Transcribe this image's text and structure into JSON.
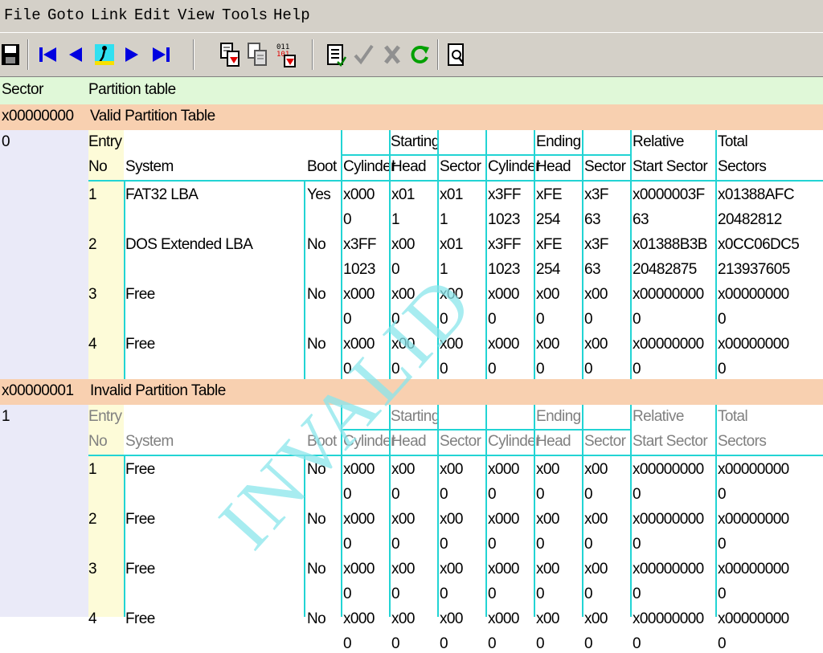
{
  "menu": [
    "File",
    "Goto",
    "Link",
    "Edit",
    "View",
    "Tools",
    "Help"
  ],
  "toolbar_icons": [
    "save-icon",
    "first-icon",
    "prev-icon",
    "walk-icon",
    "next-icon",
    "last-icon",
    "copy-sector-icon",
    "paste-sector-icon",
    "binary-icon",
    "notes-icon",
    "check-icon",
    "cancel-icon",
    "refresh-icon",
    "preview-icon"
  ],
  "header": {
    "sector": "Sector",
    "type": "Partition table"
  },
  "colors": {
    "accent_line": "#22d4d4",
    "header_bg": "#e0f8d8",
    "bar_bg": "#f8d0b0",
    "sector_bg": "#eaeaf8",
    "entry_bg": "#fdfbd8"
  },
  "tables": [
    {
      "sector_hex": "x00000000",
      "title": "Valid Partition Table",
      "sector_dec": "0",
      "cols": {
        "entry": "Entry",
        "no": "No",
        "system": "System",
        "boot": "Boot",
        "starting": "Starting",
        "ending": "Ending",
        "relative": "Relative",
        "start_sector": "Start Sector",
        "total": "Total",
        "sectors": "Sectors",
        "cylinder": "Cylinder",
        "head": "Head",
        "sector": "Sector"
      },
      "rows": [
        {
          "no": "1",
          "system": "FAT32 LBA",
          "boot": "Yes",
          "s_cyl": [
            "x000",
            "0"
          ],
          "s_head": [
            "x01",
            "1"
          ],
          "s_sec": [
            "x01",
            "1"
          ],
          "e_cyl": [
            "x3FF",
            "1023"
          ],
          "e_head": [
            "xFE",
            "254"
          ],
          "e_sec": [
            "x3F",
            "63"
          ],
          "rel": [
            "x0000003F",
            "63"
          ],
          "tot": [
            "x01388AFC",
            "20482812"
          ]
        },
        {
          "no": "2",
          "system": "DOS Extended LBA",
          "boot": "No",
          "s_cyl": [
            "x3FF",
            "1023"
          ],
          "s_head": [
            "x00",
            "0"
          ],
          "s_sec": [
            "x01",
            "1"
          ],
          "e_cyl": [
            "x3FF",
            "1023"
          ],
          "e_head": [
            "xFE",
            "254"
          ],
          "e_sec": [
            "x3F",
            "63"
          ],
          "rel": [
            "x01388B3B",
            "20482875"
          ],
          "tot": [
            "x0CC06DC5",
            "213937605"
          ]
        },
        {
          "no": "3",
          "system": "Free",
          "boot": "No",
          "s_cyl": [
            "x000",
            "0"
          ],
          "s_head": [
            "x00",
            "0"
          ],
          "s_sec": [
            "x00",
            "0"
          ],
          "e_cyl": [
            "x000",
            "0"
          ],
          "e_head": [
            "x00",
            "0"
          ],
          "e_sec": [
            "x00",
            "0"
          ],
          "rel": [
            "x00000000",
            "0"
          ],
          "tot": [
            "x00000000",
            "0"
          ]
        },
        {
          "no": "4",
          "system": "Free",
          "boot": "No",
          "s_cyl": [
            "x000",
            "0"
          ],
          "s_head": [
            "x00",
            "0"
          ],
          "s_sec": [
            "x00",
            "0"
          ],
          "e_cyl": [
            "x000",
            "0"
          ],
          "e_head": [
            "x00",
            "0"
          ],
          "e_sec": [
            "x00",
            "0"
          ],
          "rel": [
            "x00000000",
            "0"
          ],
          "tot": [
            "x00000000",
            "0"
          ]
        }
      ]
    },
    {
      "sector_hex": "x00000001",
      "title": "Invalid Partition Table",
      "sector_dec": "1",
      "watermark": "INVALID",
      "cols": {
        "entry": "Entry",
        "no": "No",
        "system": "System",
        "boot": "Boot",
        "starting": "Starting",
        "ending": "Ending",
        "relative": "Relative",
        "start_sector": "Start Sector",
        "total": "Total",
        "sectors": "Sectors",
        "cylinder": "Cylinder",
        "head": "Head",
        "sector": "Sector"
      },
      "rows": [
        {
          "no": "1",
          "system": "Free",
          "boot": "No",
          "s_cyl": [
            "x000",
            "0"
          ],
          "s_head": [
            "x00",
            "0"
          ],
          "s_sec": [
            "x00",
            "0"
          ],
          "e_cyl": [
            "x000",
            "0"
          ],
          "e_head": [
            "x00",
            "0"
          ],
          "e_sec": [
            "x00",
            "0"
          ],
          "rel": [
            "x00000000",
            "0"
          ],
          "tot": [
            "x00000000",
            "0"
          ]
        },
        {
          "no": "2",
          "system": "Free",
          "boot": "No",
          "s_cyl": [
            "x000",
            "0"
          ],
          "s_head": [
            "x00",
            "0"
          ],
          "s_sec": [
            "x00",
            "0"
          ],
          "e_cyl": [
            "x000",
            "0"
          ],
          "e_head": [
            "x00",
            "0"
          ],
          "e_sec": [
            "x00",
            "0"
          ],
          "rel": [
            "x00000000",
            "0"
          ],
          "tot": [
            "x00000000",
            "0"
          ]
        },
        {
          "no": "3",
          "system": "Free",
          "boot": "No",
          "s_cyl": [
            "x000",
            "0"
          ],
          "s_head": [
            "x00",
            "0"
          ],
          "s_sec": [
            "x00",
            "0"
          ],
          "e_cyl": [
            "x000",
            "0"
          ],
          "e_head": [
            "x00",
            "0"
          ],
          "e_sec": [
            "x00",
            "0"
          ],
          "rel": [
            "x00000000",
            "0"
          ],
          "tot": [
            "x00000000",
            "0"
          ]
        },
        {
          "no": "4",
          "system": "Free",
          "boot": "No",
          "s_cyl": [
            "x000",
            "0"
          ],
          "s_head": [
            "x00",
            "0"
          ],
          "s_sec": [
            "x00",
            "0"
          ],
          "e_cyl": [
            "x000",
            "0"
          ],
          "e_head": [
            "x00",
            "0"
          ],
          "e_sec": [
            "x00",
            "0"
          ],
          "rel": [
            "x00000000",
            "0"
          ],
          "tot": [
            "x00000000",
            "0"
          ]
        }
      ]
    }
  ]
}
